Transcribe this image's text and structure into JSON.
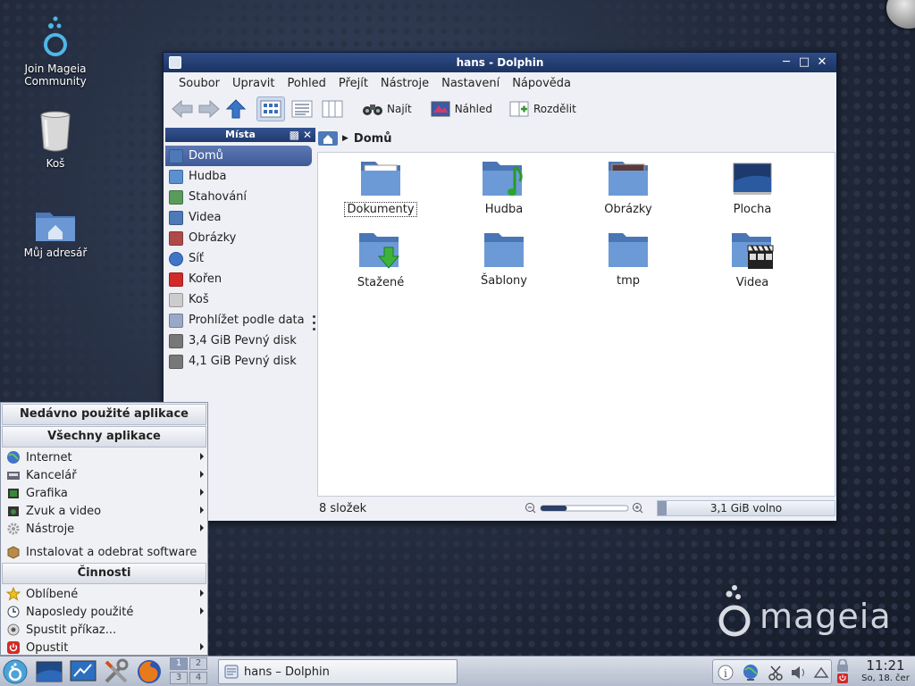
{
  "desktop": {
    "icons": [
      {
        "label_lines": [
          "Join Mageia",
          "Community"
        ]
      },
      {
        "label_lines": [
          "Koš"
        ]
      },
      {
        "label_lines": [
          "Můj adresář"
        ]
      }
    ],
    "brand": "mageia"
  },
  "window": {
    "title": "hans - Dolphin",
    "menu": [
      "Soubor",
      "Upravit",
      "Pohled",
      "Přejít",
      "Nástroje",
      "Nastavení",
      "Nápověda"
    ],
    "toolbar": {
      "find_label": "Najít",
      "preview_label": "Náhled",
      "split_label": "Rozdělit"
    },
    "places": {
      "title": "Místa",
      "items": [
        {
          "label": "Domů",
          "selected": true
        },
        {
          "label": "Hudba"
        },
        {
          "label": "Stahování"
        },
        {
          "label": "Videa"
        },
        {
          "label": "Obrázky"
        },
        {
          "label": "Síť"
        },
        {
          "label": "Kořen"
        },
        {
          "label": "Koš"
        },
        {
          "label": "Prohlížet podle data"
        },
        {
          "label": "3,4 GiB Pevný disk"
        },
        {
          "label": "4,1 GiB Pevný disk"
        }
      ]
    },
    "breadcrumb": "Domů",
    "files": [
      {
        "name": "Dokumenty",
        "icon": "folder-documents-icon"
      },
      {
        "name": "Hudba",
        "icon": "folder-music-icon"
      },
      {
        "name": "Obrázky",
        "icon": "folder-images-icon"
      },
      {
        "name": "Plocha",
        "icon": "desktop-icon"
      },
      {
        "name": "Stažené",
        "icon": "folder-download-icon"
      },
      {
        "name": "Šablony",
        "icon": "folder-icon"
      },
      {
        "name": "tmp",
        "icon": "folder-icon"
      },
      {
        "name": "Videa",
        "icon": "folder-video-icon"
      }
    ],
    "status": {
      "count": "8 složek",
      "free": "3,1 GiB volno",
      "zoom_fraction": 0.3,
      "free_used_fraction": 0.05
    }
  },
  "startmenu": {
    "recent_header": "Nedávno použité aplikace",
    "all_header": "Všechny aplikace",
    "categories": [
      "Internet",
      "Kancelář",
      "Grafika",
      "Zvuk a video",
      "Nástroje"
    ],
    "install": "Instalovat a odebrat software",
    "actions_header": "Činnosti",
    "actions": [
      "Oblíbené",
      "Naposledy použité",
      "Spustit příkaz...",
      "Opustit"
    ]
  },
  "taskbar": {
    "pager": [
      "1",
      "2",
      "3",
      "4"
    ],
    "task_label": "hans – Dolphin",
    "time": "11:21",
    "date": "So, 18. čer"
  },
  "colors": {
    "titlebar": "#1b3362",
    "selection": "#3e5b97",
    "folder": "#5b86c4"
  }
}
